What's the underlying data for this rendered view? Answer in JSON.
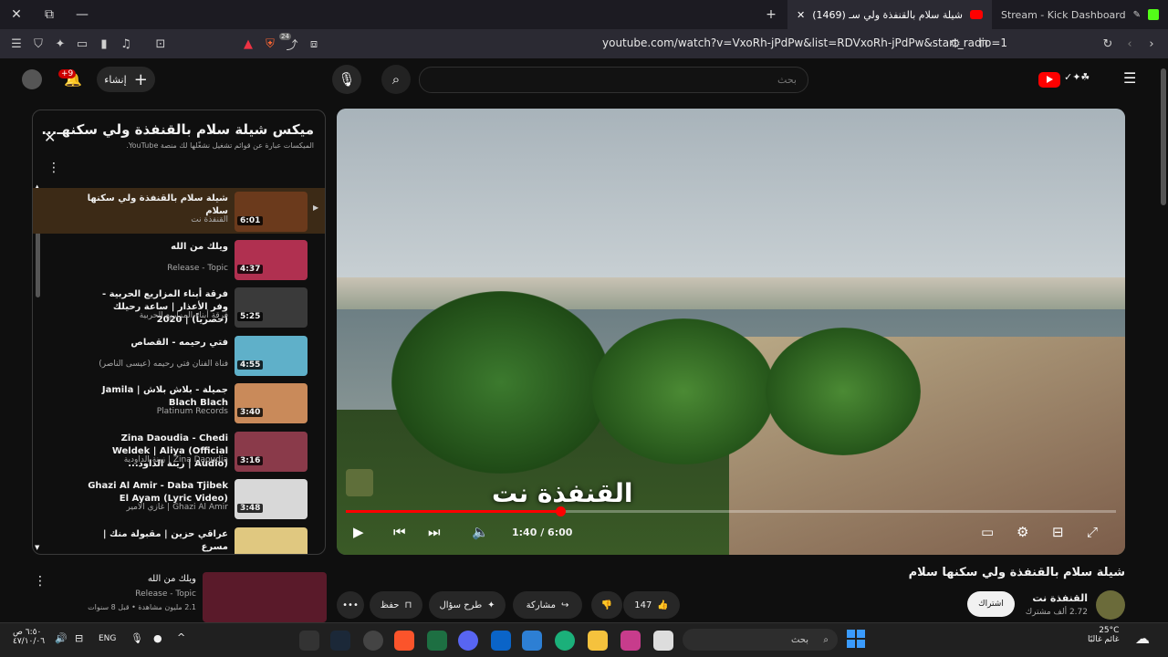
{
  "browser": {
    "tabs": [
      {
        "label": "(1469) شيلة سلام بالقنفذة ولي سـ",
        "active": true
      },
      {
        "label": "Stream - Kick Dashboard",
        "active": false
      }
    ],
    "url": "youtube.com/watch?v=VxoRh-jPdPw&list=RDVxoRh-jPdPw&start_radio=1",
    "shield_badge": "24"
  },
  "youtube": {
    "search_placeholder": "بحث",
    "create_label": "إنشاء",
    "notification_count": "+9"
  },
  "playlist": {
    "title": "ميكس شيلة سلام بالقنفذة ولي سكنهـ...",
    "subtitle": "الميكسات عبارة عن قوائم تشغيل نشغّلها لك منصة YouTube.",
    "items": [
      {
        "title": "شيلة سلام بالقنفذة ولي سكنها سلام",
        "channel": "القنفذة نت",
        "duration": "6:01",
        "color": "#6b3a1c",
        "current": true
      },
      {
        "title": "ويلك من الله",
        "channel": "Release - Topic",
        "duration": "4:37",
        "color": "#b03050",
        "current": false
      },
      {
        "title": "فرقة أبناء المزاريع الحربية - وفر الأعذار | ساعة رحيلك (حصرياً) | 2020",
        "channel": "فرقة أبناء المزاريع الحربية",
        "duration": "5:25",
        "color": "#3a3a3a",
        "current": false
      },
      {
        "title": "فتي رحيمه - القصاص",
        "channel": "فناة الفنان فتي رحيمه (عيسى الناصر)",
        "duration": "4:55",
        "color": "#5fb0c9",
        "current": false
      },
      {
        "title": "جميلة - بلاش بلاش | Jamila Blach Blach",
        "channel": "Platinum Records",
        "duration": "3:40",
        "color": "#c98a5a",
        "current": false
      },
      {
        "title": "Zina Daoudia - Chedi Weldek | Aliya (Official Audio) | زينة الداود...",
        "channel": "Zina Daoudia | زينة الداودية",
        "duration": "3:16",
        "color": "#8a3a4a",
        "current": false
      },
      {
        "title": "Ghazi Al Amir - Daba Tjibek El Ayam (Lyric Video)",
        "channel": "Ghazi Al Amir | غازي الامير",
        "duration": "3:48",
        "color": "#d8d8d8",
        "current": false
      },
      {
        "title": "عراقي حزين | مقبولة منك | مسرع",
        "channel": "",
        "duration": "",
        "color": "#e0c880",
        "current": false
      }
    ]
  },
  "player": {
    "overlay_text": "القنفذة نت",
    "time": "1:40 / 6:00",
    "progress": 0.278
  },
  "video": {
    "title": "شيلة سلام بالقنفذة ولي سكنها سلام",
    "channel": "القنفذة نت",
    "subscribers": "2.72 ألف مشترك",
    "subscribe_label": "اشتراك",
    "likes": "147",
    "share_label": "مشاركة",
    "ask_label": "طرح سؤال",
    "save_label": "حفظ"
  },
  "next_video": {
    "title": "ويلك من الله",
    "channel": "Release - Topic",
    "views": "2.1 مليون مشاهدة • قبل 8 سنوات"
  },
  "taskbar": {
    "search_label": "بحث",
    "lang": "ENG",
    "time": "٦:٥٠ ص",
    "date": "٤٧/١٠/٠٦",
    "temp": "25°C",
    "weather_desc": "غائم غالبًا"
  },
  "colors": {
    "accent_red": "#ff0000",
    "bg": "#0f0f0f"
  }
}
